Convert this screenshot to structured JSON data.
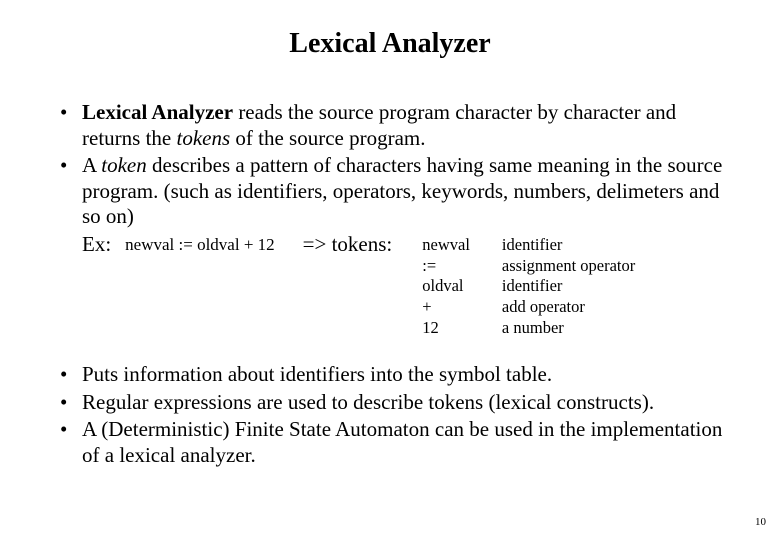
{
  "title": "Lexical Analyzer",
  "bullet1": {
    "bold": "Lexical Analyzer",
    "t1": " reads the source program character by character and returns the ",
    "italic": "tokens",
    "t2": " of the source program."
  },
  "bullet2": {
    "t1": "A ",
    "italic": "token",
    "t2": " describes a pattern of characters having same meaning in the source program. (such as identifiers, operators, keywords, numbers, delimeters and so on)"
  },
  "example": {
    "label": "Ex:",
    "code": "newval := oldval + 12",
    "arrow": "=>  tokens:",
    "tokens": [
      "newval",
      ":=",
      "oldval",
      "+",
      "12"
    ],
    "descs": [
      "identifier",
      "assignment operator",
      "identifier",
      "add operator",
      "a number"
    ]
  },
  "bullet3": "Puts information about identifiers into the symbol table.",
  "bullet4": "Regular expressions are used to describe tokens (lexical constructs).",
  "bullet5": "A (Deterministic) Finite State Automaton can be used in the implementation of a lexical analyzer.",
  "page_num": "10"
}
